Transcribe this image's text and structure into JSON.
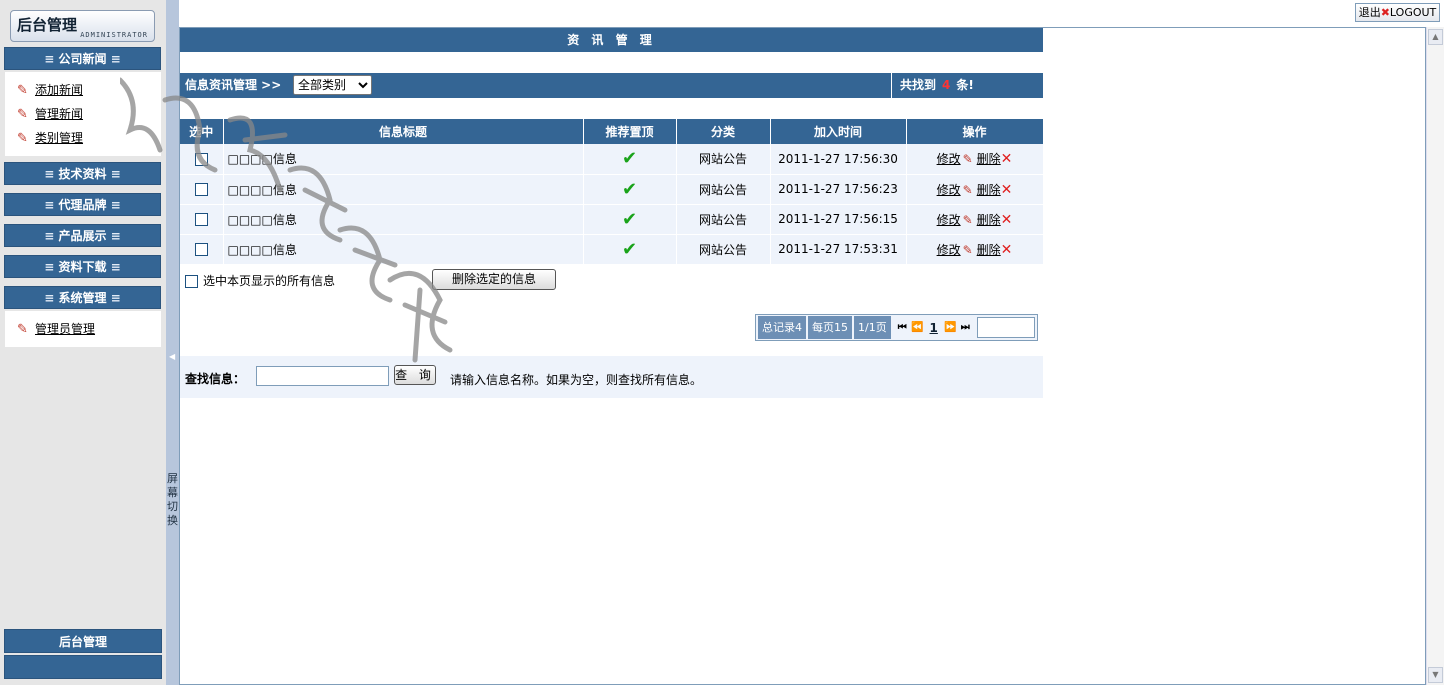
{
  "header": {
    "logout_label": "退出",
    "logout_en": "LOGOUT"
  },
  "logo": {
    "title": "后台管理",
    "subtitle": "ADMINISTRATOR"
  },
  "sidebar": {
    "groups": [
      {
        "title": "公司新闻",
        "items": [
          "添加新闻",
          "管理新闻",
          "类别管理"
        ]
      },
      {
        "title": "技术资料",
        "items": []
      },
      {
        "title": "代理品牌",
        "items": []
      },
      {
        "title": "产品展示",
        "items": []
      },
      {
        "title": "资料下载",
        "items": []
      },
      {
        "title": "系统管理",
        "items": [
          "管理员管理"
        ]
      }
    ],
    "footer": "后台管理",
    "splitter_text": "屏幕切换"
  },
  "main": {
    "title": "资 讯 管 理",
    "filter": {
      "label": "信息资讯管理 >>",
      "category_selected": "全部类别",
      "count_prefix": "共找到",
      "count_value": "4",
      "count_suffix": "条!"
    },
    "table": {
      "headers": [
        "选中",
        "信息标题",
        "推荐置顶",
        "分类",
        "加入时间",
        "操作"
      ],
      "rows": [
        {
          "title": "□□□□信息",
          "top": true,
          "category": "网站公告",
          "time": "2011-1-27 17:56:30"
        },
        {
          "title": "□□□□信息",
          "top": true,
          "category": "网站公告",
          "time": "2011-1-27 17:56:23"
        },
        {
          "title": "□□□□信息",
          "top": true,
          "category": "网站公告",
          "time": "2011-1-27 17:56:15"
        },
        {
          "title": "□□□□信息",
          "top": true,
          "category": "网站公告",
          "time": "2011-1-27 17:53:31"
        }
      ],
      "edit_label": "修改",
      "delete_label": "删除"
    },
    "select_all_label": "选中本页显示的所有信息",
    "delete_selected_label": "删除选定的信息",
    "pager": {
      "total": "总记录4",
      "per_page": "每页15",
      "pages": "1/1页",
      "current": "1"
    },
    "search": {
      "label": "查找信息：",
      "button": "查 询",
      "hint": "请输入信息名称。如果为空，则查找所有信息。"
    }
  },
  "colors": {
    "bar": "#346594",
    "row_bg": "#eef3fb",
    "sidebar_bg": "#e6e6e6"
  }
}
